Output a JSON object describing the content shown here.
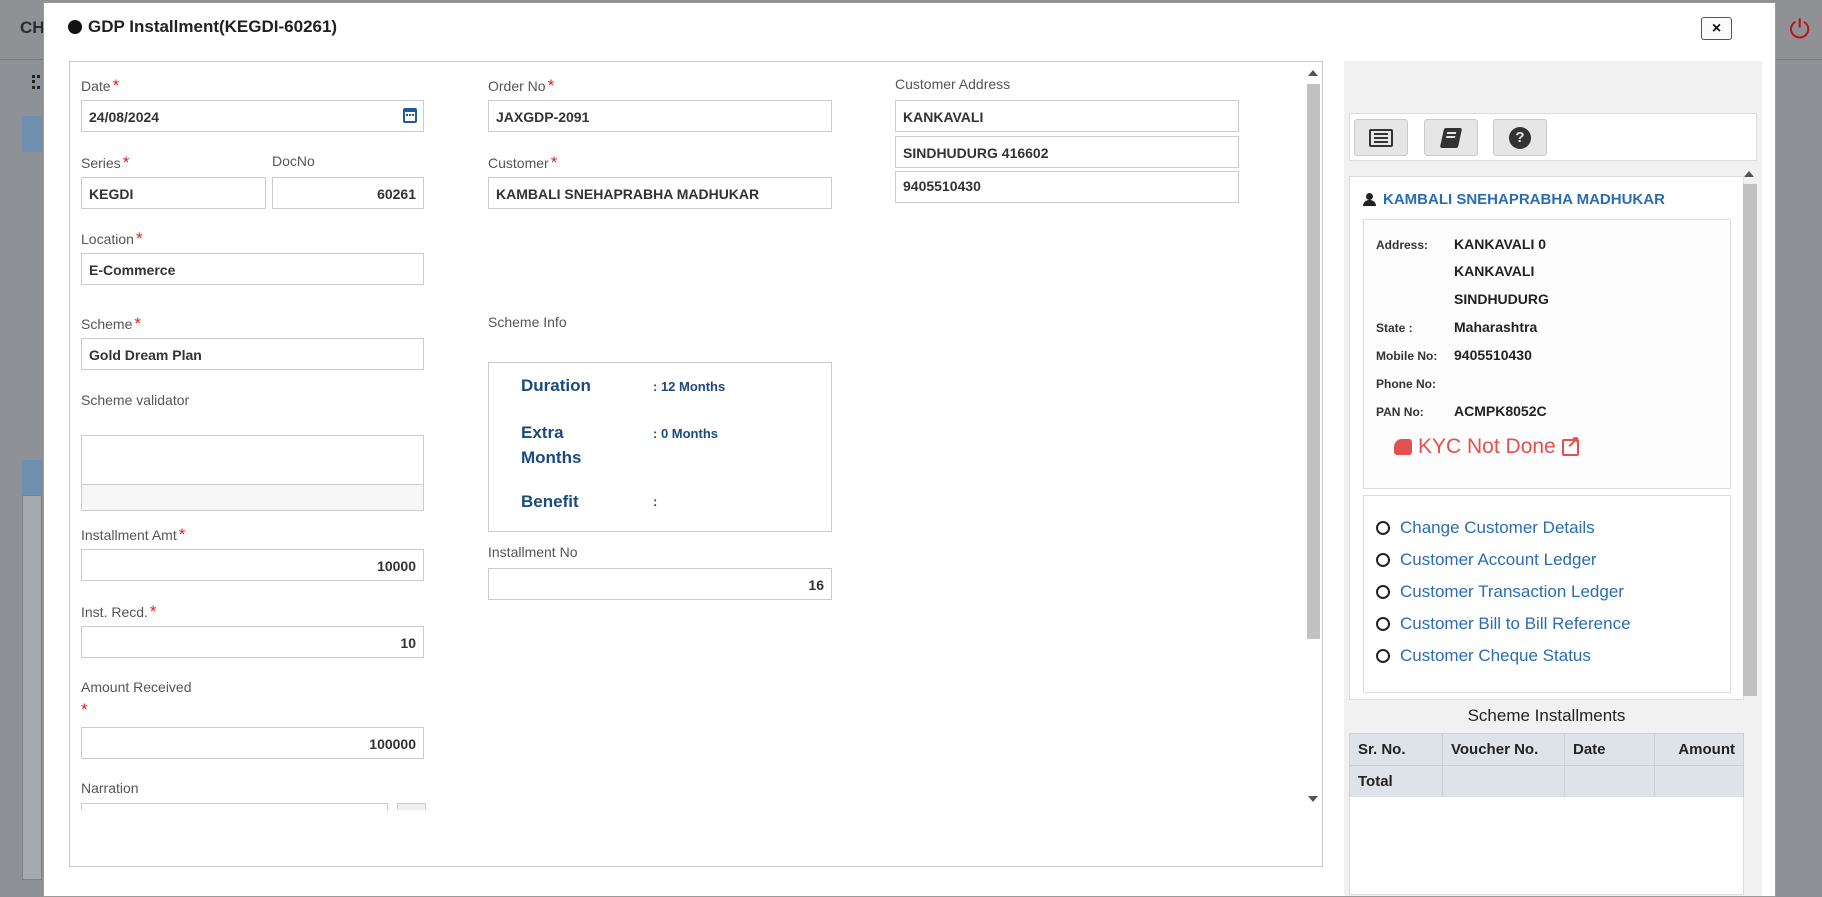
{
  "background": {
    "app_initials": "CH"
  },
  "modal": {
    "title": "GDP Installment(KEGDI-60261)",
    "close_label": "×"
  },
  "form": {
    "date": {
      "label": "Date",
      "value": "24/08/2024"
    },
    "order_no": {
      "label": "Order No",
      "value": "JAXGDP-2091"
    },
    "customer_address": {
      "label": "Customer Address",
      "line1": "KANKAVALI",
      "line2": "SINDHUDURG 416602",
      "line3": "9405510430"
    },
    "series": {
      "label": "Series",
      "value": "KEGDI"
    },
    "doc_no": {
      "label": "DocNo",
      "value": "60261"
    },
    "customer": {
      "label": "Customer",
      "value": "KAMBALI SNEHAPRABHA MADHUKAR"
    },
    "location": {
      "label": "Location",
      "value": "E-Commerce"
    },
    "scheme": {
      "label": "Scheme",
      "value": "Gold Dream Plan"
    },
    "scheme_info": {
      "label": "Scheme Info",
      "duration_label": "Duration",
      "duration_value": ": 12 Months",
      "extra_label_1": "Extra",
      "extra_label_2": "Months",
      "extra_value": ": 0 Months",
      "benefit_label": "Benefit",
      "benefit_value": ":"
    },
    "scheme_validator": {
      "label": "Scheme validator"
    },
    "installment_amt": {
      "label": "Installment Amt",
      "value": "10000"
    },
    "installment_no": {
      "label": "Installment No",
      "value": "16"
    },
    "inst_recd": {
      "label": "Inst. Recd.",
      "value": "10"
    },
    "amount_received": {
      "label": "Amount Received",
      "value": "100000"
    },
    "narration": {
      "label": "Narration"
    },
    "required_mark": "*"
  },
  "customer_panel": {
    "name": "KAMBALI SNEHAPRABHA MADHUKAR",
    "address_label": "Address:",
    "address_line1": "KANKAVALI 0",
    "address_line2": "KANKAVALI",
    "address_line3": "SINDHUDURG",
    "state_label": "State :",
    "state_value": "Maharashtra",
    "mobile_label": "Mobile No:",
    "mobile_value": "9405510430",
    "phone_label": "Phone No:",
    "phone_value": "",
    "pan_label": "PAN No:",
    "pan_value": "ACMPK8052C",
    "kyc_status": "KYC Not Done",
    "links": [
      "Change Customer Details",
      "Customer Account Ledger",
      "Customer Transaction Ledger",
      "Customer Bill to Bill Reference",
      "Customer Cheque Status"
    ]
  },
  "installments": {
    "title": "Scheme Installments",
    "columns": [
      "Sr. No.",
      "Voucher No.",
      "Date",
      "Amount"
    ],
    "total_label": "Total"
  },
  "colors": {
    "accent": "#2a6db0",
    "required": "#e02020",
    "kyc": "#e45050",
    "scheme_info": "#1d4a7e"
  },
  "icons": [
    "circle-bullet-icon",
    "close-icon",
    "calendar-icon",
    "list-icon",
    "book-icon",
    "help-icon",
    "user-icon",
    "thumbs-down-icon",
    "external-link-icon",
    "power-icon"
  ]
}
